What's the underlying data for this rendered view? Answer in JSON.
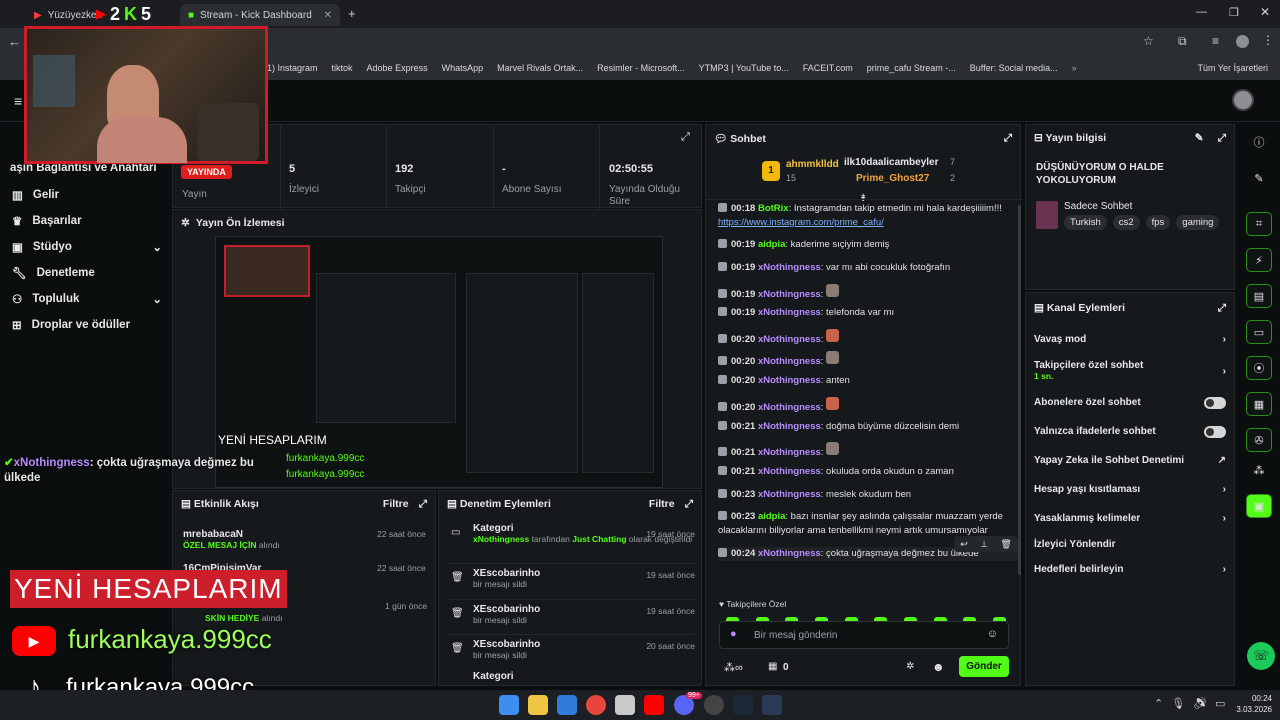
{
  "browser": {
    "tabs": [
      "Yüzüyezken",
      "2",
      "5",
      "Stream - Kick Dashboard"
    ],
    "bookmarks": [
      "(1) Instagram",
      "tiktok",
      "Adobe Express",
      "WhatsApp",
      "Marvel Rivals Ortak...",
      "Resimler - Microsoft...",
      "YTMP3 | YouTube to...",
      "FACEIT.com",
      "prime_cafu Stream -...",
      "Buffer: Social media..."
    ],
    "all_bookmarks": "Tüm Yer İşaretleri"
  },
  "sidebar": {
    "partial": "aşın Bağlantısı ve Anahtarı",
    "items": [
      "Gelir",
      "Başarılar",
      "Stüdyo",
      "Denetleme",
      "Topluluk",
      "Droplar ve ödüller"
    ]
  },
  "stats": {
    "live_badge": "YAYINDA",
    "live_label": "Yayın",
    "viewers": "5",
    "viewers_label": "İzleyici",
    "followers": "192",
    "followers_label": "Takipçi",
    "subs": "-",
    "subs_label": "Abone Sayısı",
    "duration": "02:50:55",
    "duration_label": "Yayında Olduğu Süre"
  },
  "preview": {
    "title": "Yayın Ön İzlemesi",
    "mini_caption": "YENİ HESAPLARIM",
    "mini_handle1": "furkankaya.999cc",
    "mini_handle2": "furkankaya.999cc"
  },
  "overlay": {
    "chat_user": "xNothingness",
    "chat_text": ": çokta uğraşmaya değmez bu ülkede",
    "banner": "YENİ HESAPLARIM",
    "yt_handle": "furkankaya.999cc",
    "tt_handle": "furkankaya.999cc",
    "cam_badge_k1": "2",
    "cam_badge_k2": "5"
  },
  "activity": {
    "title": "Etkinlik Akışı",
    "filter": "Filtre",
    "items": [
      {
        "user": "mrebabacaN",
        "highlight": "ÖZEL MESAJ İÇİN",
        "suffix": " alındı",
        "time": "22 saat önce"
      },
      {
        "user": "16CmPipisimVar",
        "highlight": "",
        "suffix": "",
        "time": "22 saat önce"
      },
      {
        "user": "",
        "highlight": "SKİN HEDİYE",
        "suffix": " alındı",
        "time": "1 gün önce"
      }
    ]
  },
  "moderation": {
    "title": "Denetim Eylemleri",
    "filter": "Filtre",
    "items": [
      {
        "title": "Kategori",
        "user": "xNothingness",
        "mid": " tarafından ",
        "cat": "Just Chatting",
        "end": " olarak değiştirildi",
        "time": "19 saat önce"
      },
      {
        "title": "XEscobarinho",
        "sub": "bir mesajı sildi",
        "time": "19 saat önce"
      },
      {
        "title": "XEscobarinho",
        "sub": "bir mesajı sildi",
        "time": "19 saat önce"
      },
      {
        "title": "XEscobarinho",
        "sub": "bir mesajı sildi",
        "time": "20 saat önce"
      },
      {
        "title": "Kategori",
        "sub": "",
        "time": ""
      }
    ]
  },
  "chat": {
    "title": "Sohbet",
    "top1_name": "ahmmklldd",
    "top1_count": "15",
    "top2_name": "ilk10daalicambeyler",
    "top2_count": "7",
    "top3_name": "Prime_Ghost27",
    "top3_count": "2",
    "messages": [
      {
        "time": "00:18",
        "user": "BotRix",
        "text": ": Instagramdan takip etmedin mi hala kardeşiiiiim!!! ",
        "link": "https://www.instagram.com/prime_cafu/"
      },
      {
        "time": "00:19",
        "user": "aidpia",
        "text": ": kaderime sıçiyim demiş"
      },
      {
        "time": "00:19",
        "user": "xNothingness",
        "text": ": var mı abi cocukluk fotoğrafın"
      },
      {
        "time": "00:19",
        "user": "xNothingness",
        "text": ":"
      },
      {
        "time": "00:19",
        "user": "xNothingness",
        "text": ": telefonda var mı"
      },
      {
        "time": "00:20",
        "user": "xNothingness",
        "text": ":"
      },
      {
        "time": "00:20",
        "user": "xNothingness",
        "text": ":"
      },
      {
        "time": "00:20",
        "user": "xNothingness",
        "text": ": anten"
      },
      {
        "time": "00:20",
        "user": "xNothingness",
        "text": ":"
      },
      {
        "time": "00:21",
        "user": "xNothingness",
        "text": ": doğma büyüme düzcelisin demi"
      },
      {
        "time": "00:21",
        "user": "xNothingness",
        "text": ":"
      },
      {
        "time": "00:21",
        "user": "xNothingness",
        "text": ": okuluda orda okudun o zaman"
      },
      {
        "time": "00:23",
        "user": "xNothingness",
        "text": ": meslek okudum ben"
      },
      {
        "time": "00:23",
        "user": "aidpia",
        "text": ": bazı insnlar şey aslında çalışsalar muazzam yerde olacaklarını biliyorlar ama tenbellikmi neymi artık umursamıyolar"
      },
      {
        "time": "00:24",
        "user": "xNothingness",
        "text": ": çokta uğraşmaya değmez bu ülkede"
      }
    ],
    "followers_only": "Takipçilere Özel",
    "placeholder": "Bir mesaj gönderin",
    "points": "0",
    "send": "Gönder"
  },
  "stream_info": {
    "title": "Yayın bilgisi",
    "stream_title": "DÜŞÜNÜYORUM O HALDE YOKOLUYORUM",
    "category": "Sadece Sohbet",
    "tags": [
      "Turkish",
      "cs2",
      "fps",
      "gaming"
    ]
  },
  "channel_actions": {
    "title": "Kanal Eylemleri",
    "rows": [
      {
        "label": "Vavaş mod",
        "sub": "",
        "kind": "chev"
      },
      {
        "label": "Takipçilere özel sohbet",
        "sub": "1 sn.",
        "kind": "chev"
      },
      {
        "label": "Abonelere özel sohbet",
        "sub": "",
        "kind": "toggle"
      },
      {
        "label": "Yalnızca ifadelerle sohbet",
        "sub": "",
        "kind": "toggle"
      },
      {
        "label": "Yapay Zeka ile Sohbet Denetimi",
        "sub": "",
        "kind": "ext"
      },
      {
        "label": "Hesap yaşı kısıtlaması",
        "sub": "",
        "kind": "chev"
      },
      {
        "label": "Yasaklanmış kelimeler",
        "sub": "",
        "kind": "chev"
      },
      {
        "label": "İzleyici Yönlendir",
        "sub": "",
        "kind": "none"
      },
      {
        "label": "Hedefleri belirleyin",
        "sub": "",
        "kind": "chev"
      }
    ]
  },
  "taskbar": {
    "time": "00:24",
    "date": "3.03.2026",
    "badge": "99+"
  }
}
